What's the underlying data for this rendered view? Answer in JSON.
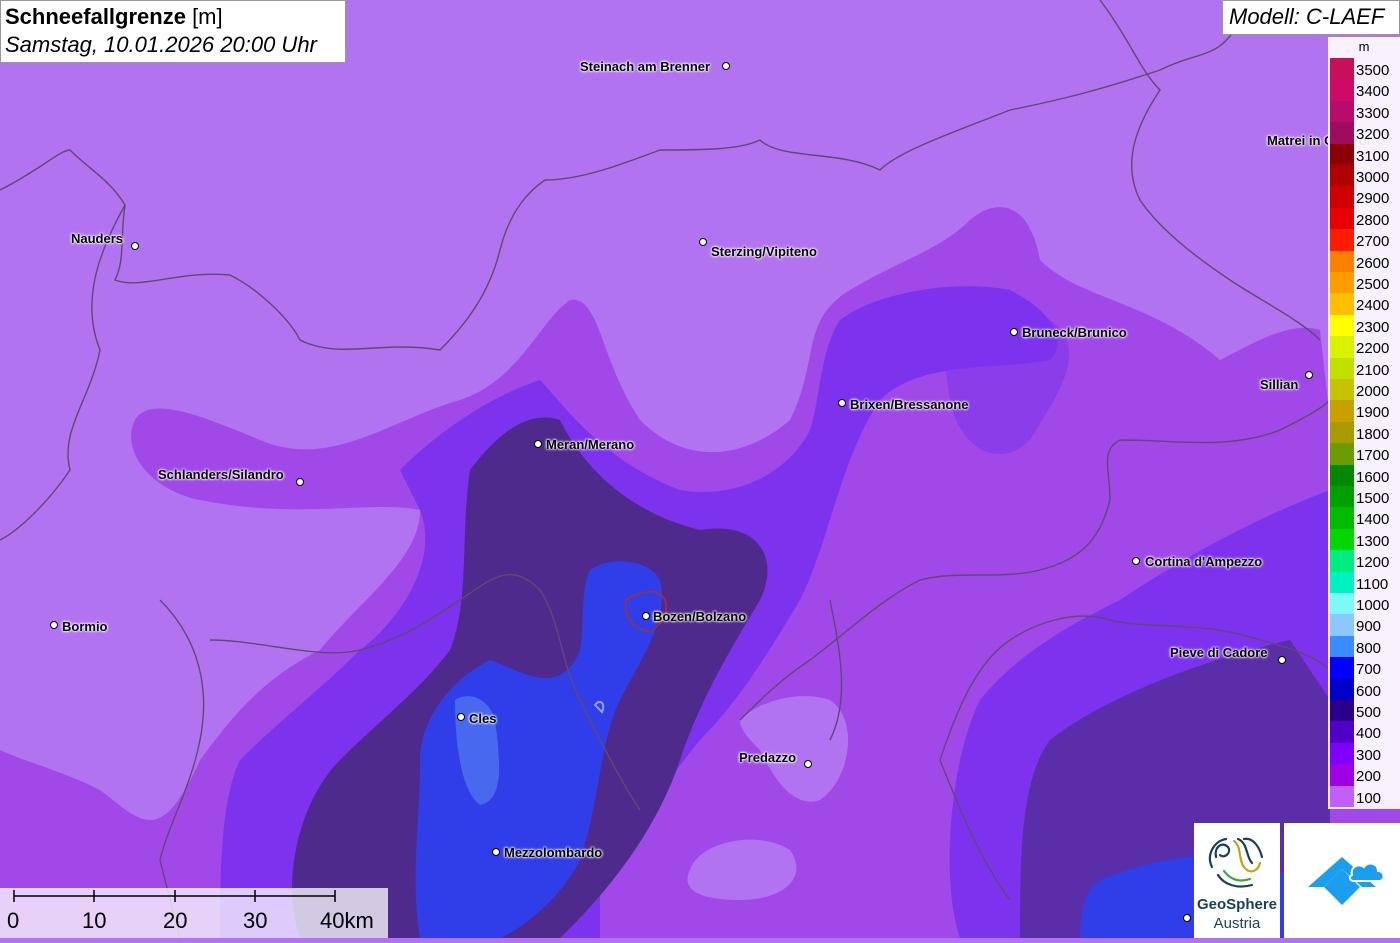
{
  "header": {
    "title_bold": "Schneefallgrenze",
    "title_unit": " [m]",
    "subtitle": "Samstag, 10.01.2026 20:00 Uhr"
  },
  "model": {
    "label": "Modell: C-LAEF"
  },
  "legend": {
    "unit": "m",
    "items": [
      {
        "value": "3500",
        "color": "#c8105a"
      },
      {
        "value": "3400",
        "color": "#cf0a66"
      },
      {
        "value": "3300",
        "color": "#b80c6c"
      },
      {
        "value": "3200",
        "color": "#a00b62"
      },
      {
        "value": "3100",
        "color": "#8c0005"
      },
      {
        "value": "3000",
        "color": "#b00000"
      },
      {
        "value": "2900",
        "color": "#d00000"
      },
      {
        "value": "2800",
        "color": "#e80000"
      },
      {
        "value": "2700",
        "color": "#ff1a00"
      },
      {
        "value": "2600",
        "color": "#ff7f00"
      },
      {
        "value": "2500",
        "color": "#ff9d00"
      },
      {
        "value": "2400",
        "color": "#ffbf00"
      },
      {
        "value": "2300",
        "color": "#ffff00"
      },
      {
        "value": "2200",
        "color": "#d8f200"
      },
      {
        "value": "2100",
        "color": "#c2e000"
      },
      {
        "value": "2000",
        "color": "#c6c400"
      },
      {
        "value": "1900",
        "color": "#c8a000"
      },
      {
        "value": "1800",
        "color": "#a89b00"
      },
      {
        "value": "1700",
        "color": "#6c9c00"
      },
      {
        "value": "1600",
        "color": "#008a00"
      },
      {
        "value": "1500",
        "color": "#00a000"
      },
      {
        "value": "1400",
        "color": "#00bb00"
      },
      {
        "value": "1300",
        "color": "#00d800"
      },
      {
        "value": "1200",
        "color": "#00ee80"
      },
      {
        "value": "1100",
        "color": "#00f2c0"
      },
      {
        "value": "1000",
        "color": "#7ff8f8"
      },
      {
        "value": "900",
        "color": "#8ac8ff"
      },
      {
        "value": "800",
        "color": "#3a8cff"
      },
      {
        "value": "700",
        "color": "#0000ff"
      },
      {
        "value": "600",
        "color": "#0000c8"
      },
      {
        "value": "500",
        "color": "#2a008a"
      },
      {
        "value": "400",
        "color": "#5000c8"
      },
      {
        "value": "300",
        "color": "#7f00ff"
      },
      {
        "value": "200",
        "color": "#a000e6"
      },
      {
        "value": "100",
        "color": "#c060f8"
      }
    ]
  },
  "cities": [
    {
      "name": "Steinach am Brenner",
      "label_side": "left"
    },
    {
      "name": "Nauders",
      "label_side": "left"
    },
    {
      "name": "Sterzing/Vipiteno",
      "label_side": "right"
    },
    {
      "name": "Matrei in Osttirol",
      "label_side": "left"
    },
    {
      "name": "Bruneck/Brunico",
      "label_side": "right"
    },
    {
      "name": "Sillian",
      "label_side": "left"
    },
    {
      "name": "Brixen/Bressanone",
      "label_side": "right"
    },
    {
      "name": "Meran/Merano",
      "label_side": "right"
    },
    {
      "name": "Schlanders/Silandro",
      "label_side": "left"
    },
    {
      "name": "Cortina d'Ampezzo",
      "label_side": "right"
    },
    {
      "name": "Bormio",
      "label_side": "right"
    },
    {
      "name": "Bozen/Bolzano",
      "label_side": "right"
    },
    {
      "name": "Pieve di Cadore",
      "label_side": "left"
    },
    {
      "name": "Cles",
      "label_side": "right"
    },
    {
      "name": "Predazzo",
      "label_side": "left"
    },
    {
      "name": "Mezzolombardo",
      "label_side": "right"
    }
  ],
  "scale_bar": {
    "labels": [
      "0",
      "10",
      "20",
      "30",
      "40km"
    ]
  },
  "logos": {
    "geosphere_line1": "GeoSphere",
    "geosphere_line2": "Austria"
  },
  "colors": {
    "base": "#b273f0",
    "band_200": "#a049e8",
    "band_300": "#7d33ee",
    "band_500": "#4d2a8c",
    "band_700": "#2f3ee8"
  }
}
